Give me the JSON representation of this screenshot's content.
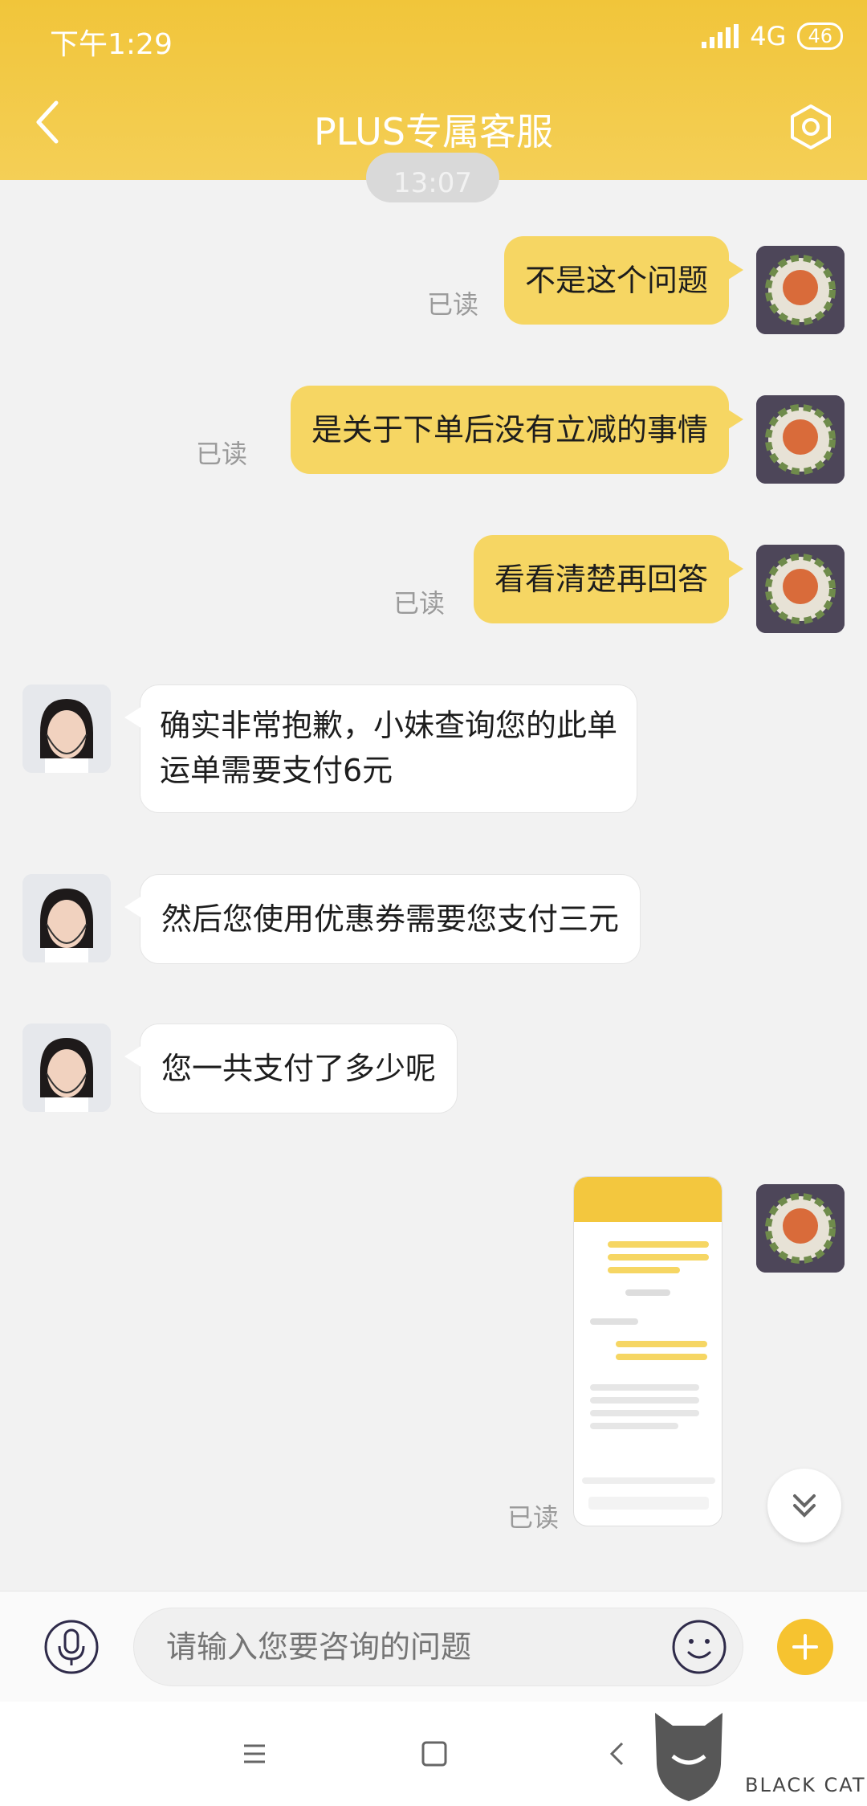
{
  "status_bar": {
    "time": "下午1:29",
    "network": "4G",
    "battery": "46"
  },
  "header": {
    "title": "PLUS专属客服"
  },
  "time_separator": "13:07",
  "messages": [
    {
      "side": "out",
      "text": "不是这个问题",
      "read_label": "已读"
    },
    {
      "side": "out",
      "text": "是关于下单后没有立减的事情",
      "read_label": "已读"
    },
    {
      "side": "out",
      "text": "看看清楚再回答",
      "read_label": "已读"
    },
    {
      "side": "in",
      "line1": "确实非常抱歉，小妹查询您的此单",
      "line2": "运单需要支付6元"
    },
    {
      "side": "in",
      "text": "然后您使用优惠券需要您支付三元"
    },
    {
      "side": "in",
      "text": "您一共支付了多少呢"
    },
    {
      "side": "out",
      "type": "image",
      "read_label": "已读"
    }
  ],
  "input": {
    "placeholder": "请输入您要咨询的问题"
  },
  "watermark": {
    "cn": "黑猫",
    "en": "BLACK CAT"
  },
  "colors": {
    "header": "#f1c53a",
    "bubble_out": "#f6d663",
    "accent": "#f6c330"
  },
  "icons": [
    "back-icon",
    "settings-icon",
    "mic-icon",
    "emoji-icon",
    "plus-icon",
    "scroll-down-icon",
    "menu-icon",
    "home-icon",
    "nav-back-icon"
  ]
}
